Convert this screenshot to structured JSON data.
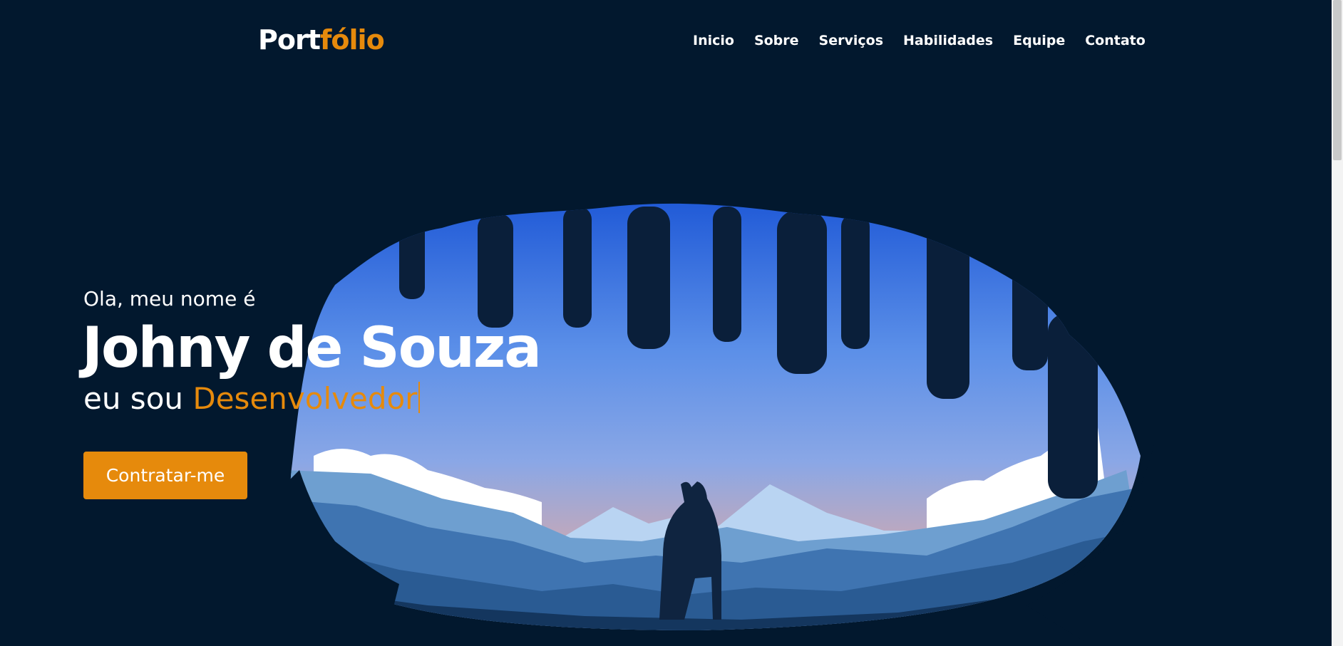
{
  "header": {
    "logo_main": "Port",
    "logo_accent": "fólio",
    "nav": [
      "Inicio",
      "Sobre",
      "Serviços",
      "Habilidades",
      "Equipe",
      "Contato"
    ]
  },
  "hero": {
    "greeting": "Ola, meu nome é",
    "name": "Johny de Souza",
    "role_prefix": "eu sou",
    "role": "Desenvolvedor",
    "cta_label": "Contratar-me"
  },
  "colors": {
    "background": "#02182e",
    "accent": "#e68a0c",
    "text": "#ffffff"
  }
}
